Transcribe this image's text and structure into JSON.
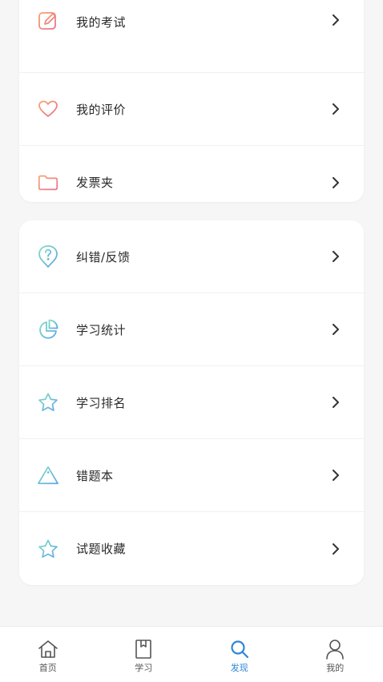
{
  "group1": {
    "items": [
      {
        "label": "我的考试",
        "icon": "edit-icon"
      },
      {
        "label": "我的评价",
        "icon": "heart-icon"
      },
      {
        "label": "发票夹",
        "icon": "folder-icon"
      }
    ]
  },
  "group2": {
    "items": [
      {
        "label": "纠错/反馈",
        "icon": "help-pin-icon"
      },
      {
        "label": "学习统计",
        "icon": "pie-chart-icon"
      },
      {
        "label": "学习排名",
        "icon": "star-icon"
      },
      {
        "label": "错题本",
        "icon": "warning-icon"
      },
      {
        "label": "试题收藏",
        "icon": "star-icon"
      }
    ]
  },
  "tabbar": {
    "tabs": [
      {
        "label": "首页",
        "icon": "home-icon"
      },
      {
        "label": "学习",
        "icon": "book-icon"
      },
      {
        "label": "发现",
        "icon": "search-icon",
        "active": true
      },
      {
        "label": "我的",
        "icon": "user-icon"
      }
    ]
  },
  "colors": {
    "accent": "#2f86d6",
    "warm_gradient_start": "#f4a27a",
    "warm_gradient_end": "#ef6f8e",
    "cool_gradient_start": "#7ed6c0",
    "cool_gradient_end": "#5aa8e6"
  }
}
